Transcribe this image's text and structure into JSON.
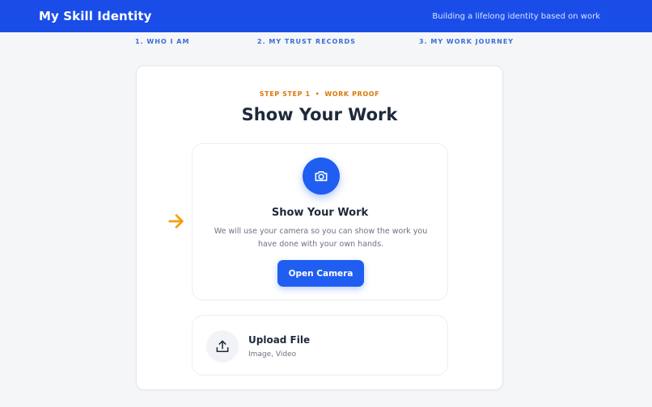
{
  "header": {
    "app_title": "My Skill Identity",
    "tagline": "Building a lifelong identity based on work"
  },
  "steps": [
    {
      "label": "1. WHO I AM"
    },
    {
      "label": "2. MY TRUST RECORDS"
    },
    {
      "label": "3. MY WORK JOURNEY"
    }
  ],
  "card": {
    "step_label": "STEP STEP 1",
    "separator": "•",
    "section_label": "WORK PROOF",
    "title": "Show Your Work",
    "camera_option": {
      "icon": "camera-icon",
      "title": "Show Your Work",
      "description": "We will use your camera so you can show the work you have done with your own hands.",
      "button_label": "Open Camera"
    },
    "upload_option": {
      "icon": "upload-icon",
      "title": "Upload File",
      "subtitle": "Image, Video"
    },
    "pointer_icon": "arrow-right-icon"
  },
  "colors": {
    "header_bg": "#1a4de8",
    "primary": "#1f5ef0",
    "accent": "#d97706",
    "arrow": "#f59e0b"
  }
}
